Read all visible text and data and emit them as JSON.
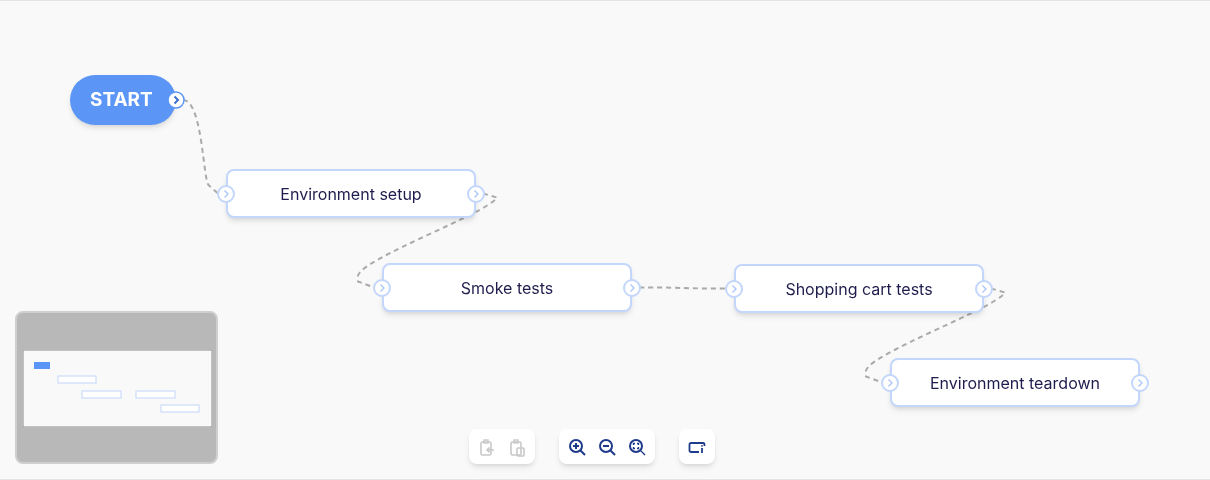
{
  "nodes": [
    {
      "kind": "start",
      "label": "START"
    },
    {
      "kind": "task",
      "label": "Environment setup"
    },
    {
      "kind": "task",
      "label": "Smoke tests"
    },
    {
      "kind": "task",
      "label": "Shopping cart tests"
    },
    {
      "kind": "task",
      "label": "Environment teardown"
    }
  ],
  "toolbar": [
    [
      {
        "kind": "copy",
        "disabled": true
      },
      {
        "kind": "paste",
        "disabled": true
      }
    ],
    [
      {
        "kind": "zoom_in",
        "disabled": false
      },
      {
        "kind": "zoom_out",
        "disabled": false
      },
      {
        "kind": "zoom_fit",
        "disabled": false
      }
    ],
    [
      {
        "kind": "info",
        "disabled": false
      }
    ]
  ]
}
